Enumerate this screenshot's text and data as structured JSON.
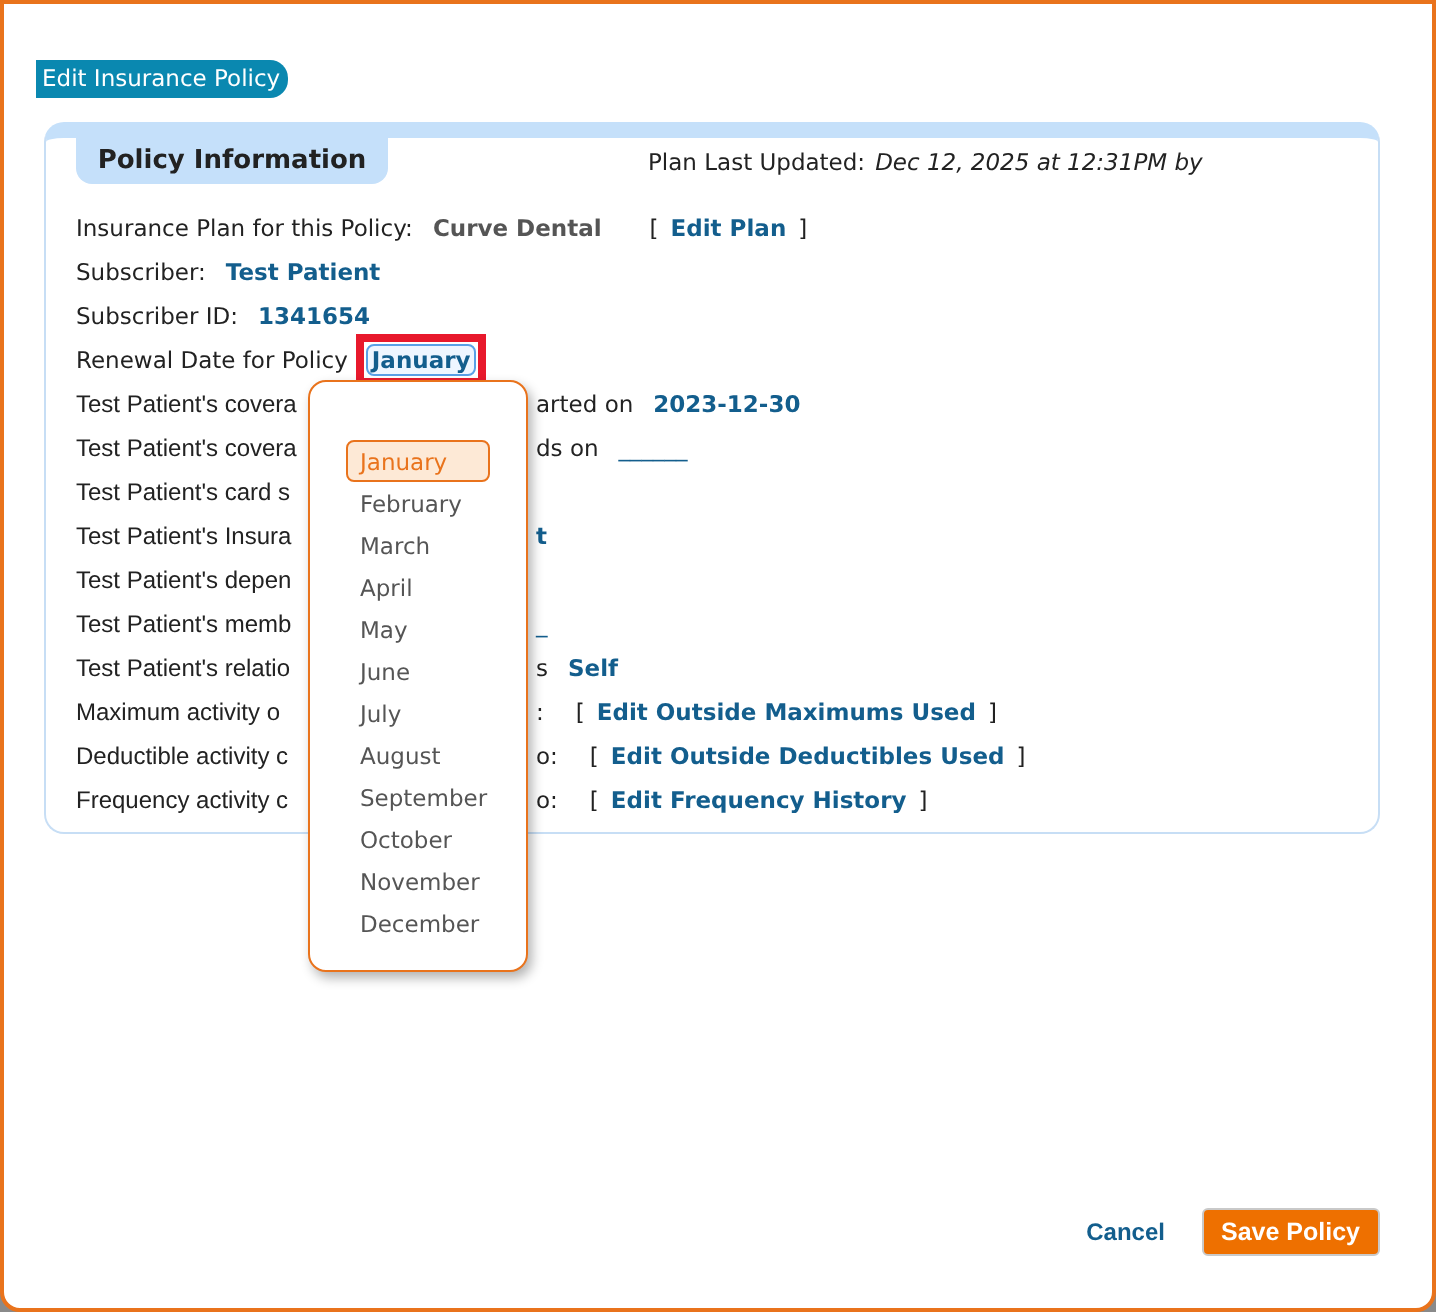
{
  "title": "Edit Insurance Policy",
  "section": {
    "tab": "Policy Information",
    "updated_label": "Plan Last Updated:",
    "updated_value": "Dec 12, 2025 at 12:31PM by"
  },
  "rows": [
    {
      "kind": "plan",
      "label": "Insurance Plan for this Policy:",
      "value": "Curve Dental",
      "link": {
        "open": "[",
        "text": "Edit Plan",
        "close": "]"
      }
    },
    {
      "kind": "plain",
      "label": "Subscriber:",
      "value": "Test Patient"
    },
    {
      "kind": "plain",
      "label": "Subscriber ID:",
      "value": "1341654"
    },
    {
      "kind": "select",
      "label": "Renewal Date for Policy",
      "value": "January",
      "highlighted": true
    },
    {
      "kind": "partial",
      "left": "Test Patient's covera",
      "right": "arted on",
      "value": "2023-12-30"
    },
    {
      "kind": "partial",
      "left": "Test Patient's covera",
      "right": "ds on",
      "blank": "______"
    },
    {
      "kind": "partial",
      "left": "Test Patient's card s"
    },
    {
      "kind": "partial",
      "left": "Test Patient's Insura",
      "value": "t"
    },
    {
      "kind": "partial",
      "left": "Test Patient's depen"
    },
    {
      "kind": "partial",
      "left": "Test Patient's memb",
      "blank": "_"
    },
    {
      "kind": "partial",
      "left": "Test Patient's relatio",
      "right": "s",
      "value": "Self"
    },
    {
      "kind": "partial",
      "left": "Maximum activity o",
      "right": ":",
      "link": {
        "open": "[",
        "text": "Edit Outside Maximums Used",
        "close": "]"
      }
    },
    {
      "kind": "partial",
      "left": "Deductible activity c",
      "right": "o:",
      "link": {
        "open": "[",
        "text": "Edit Outside Deductibles Used",
        "close": "]"
      }
    },
    {
      "kind": "partial",
      "left": "Frequency activity c",
      "right": "o:",
      "link": {
        "open": "[",
        "text": "Edit Frequency History",
        "close": "]"
      }
    }
  ],
  "dropdown": {
    "options": [
      {
        "label": "January",
        "selected": true
      },
      {
        "label": "February",
        "selected": false
      },
      {
        "label": "March",
        "selected": false
      },
      {
        "label": "April",
        "selected": false
      },
      {
        "label": "May",
        "selected": false
      },
      {
        "label": "June",
        "selected": false
      },
      {
        "label": "July",
        "selected": false
      },
      {
        "label": "August",
        "selected": false
      },
      {
        "label": "September",
        "selected": false
      },
      {
        "label": "October",
        "selected": false
      },
      {
        "label": "November",
        "selected": false
      },
      {
        "label": "December",
        "selected": false
      }
    ]
  },
  "buttons": {
    "cancel": "Cancel",
    "save": "Save Policy"
  }
}
